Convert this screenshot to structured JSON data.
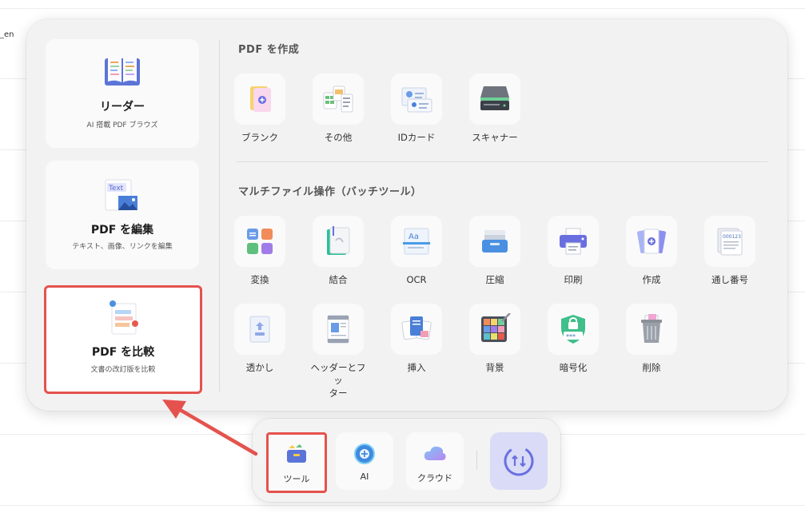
{
  "background": {
    "fragment": "_en"
  },
  "left_cards": {
    "reader": {
      "title": "リーダー",
      "subtitle": "AI 搭載 PDF ブラウズ"
    },
    "edit": {
      "title": "PDF を編集",
      "subtitle": "テキスト、画像、リンクを編集",
      "icon_text": "Text"
    },
    "compare": {
      "title": "PDF を比較",
      "subtitle": "文書の改訂版を比較"
    }
  },
  "sections": {
    "create": {
      "title": "PDF を作成",
      "tools": [
        "ブランク",
        "その他",
        "IDカード",
        "スキャナー"
      ]
    },
    "batch": {
      "title": "マルチファイル操作（バッチツール）",
      "row1": [
        "変換",
        "結合",
        "OCR",
        "圧縮",
        "印刷",
        "作成",
        "通し番号"
      ],
      "row2": [
        "透かし",
        "ヘッダーとフッ",
        "挿入",
        "背景",
        "暗号化",
        "削除"
      ],
      "row2_extra": "ター"
    }
  },
  "icons": {
    "ocr_text": "Aa",
    "number_text": "000123",
    "encrypt_text": "***"
  },
  "dock": {
    "tools_label": "ツール",
    "ai_label": "AI",
    "cloud_label": "クラウド"
  },
  "colors": {
    "highlight": "#e5524d",
    "panel_bg": "#f2f2f3",
    "sync_bg": "#d9dbf7",
    "accent": "#6a6fe0"
  }
}
